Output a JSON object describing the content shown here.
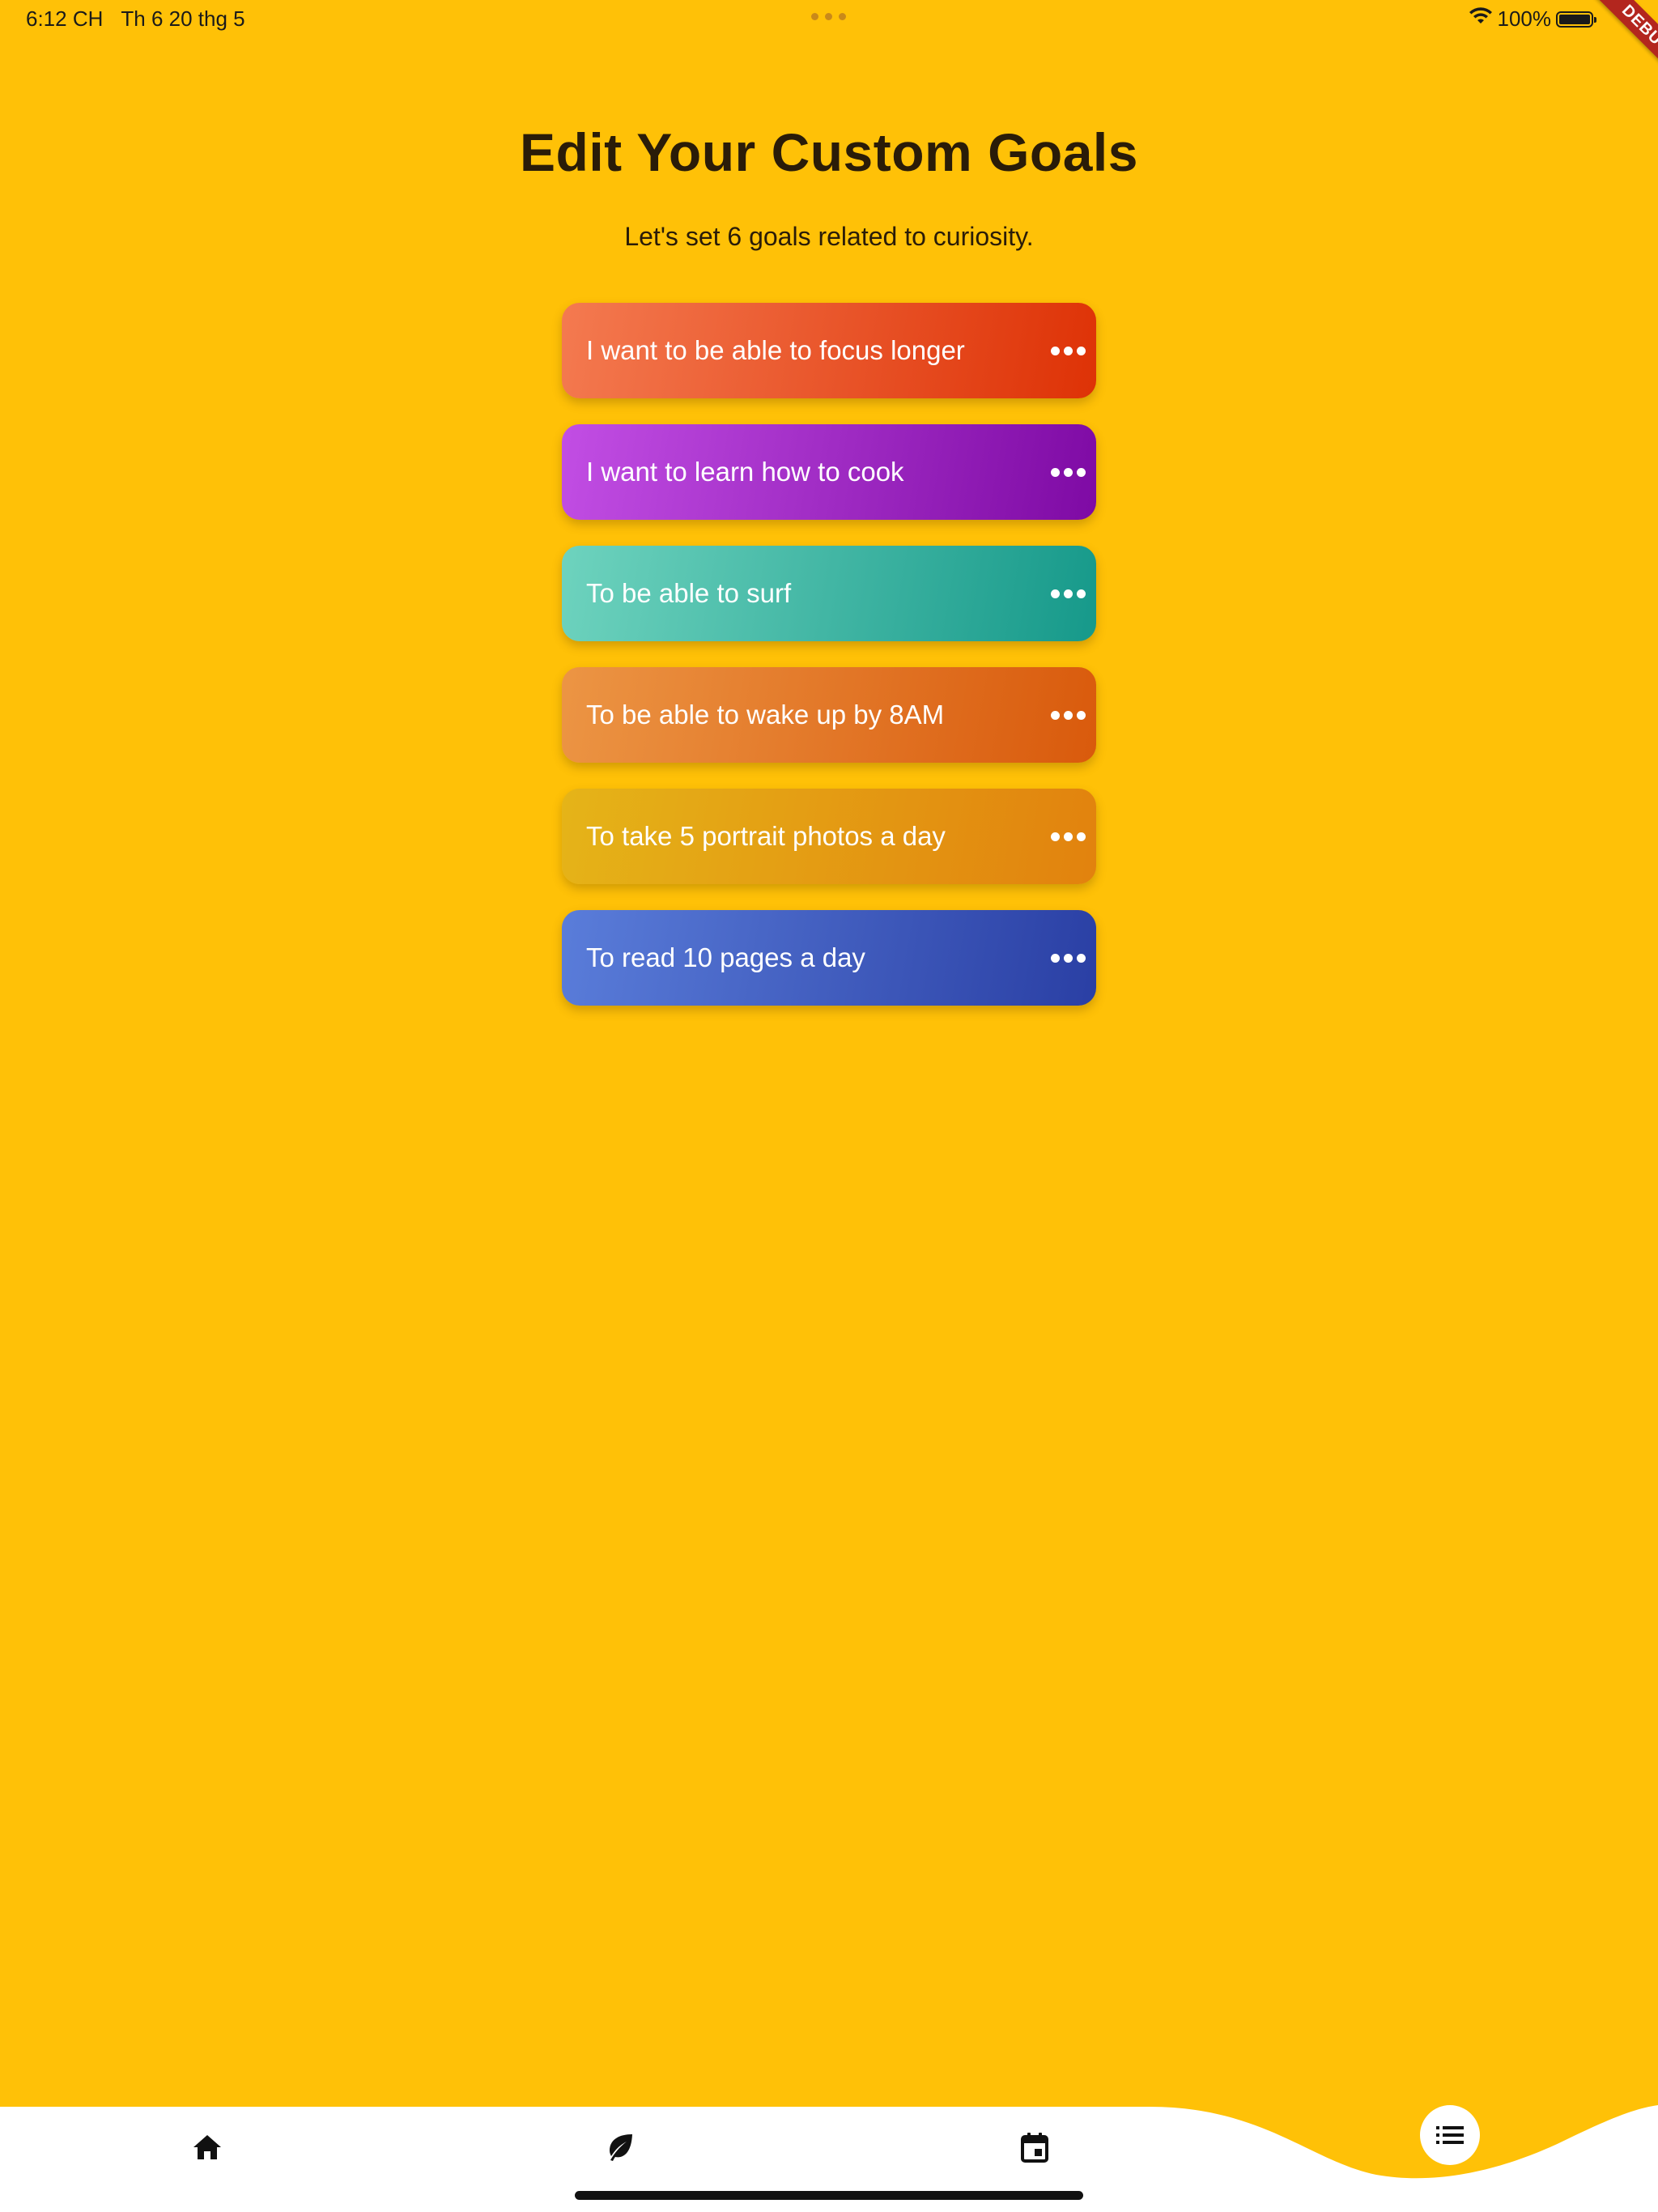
{
  "colors": {
    "background": "#FFC107",
    "nav_background": "#FFFFFF",
    "text_dark": "#2A1C08",
    "debug_banner": "#B3261E"
  },
  "status_bar": {
    "time": "6:12 CH",
    "date": "Th 6 20 thg 5",
    "battery": "100%",
    "wifi_icon": "wifi-icon",
    "battery_icon": "battery-icon"
  },
  "debug_banner": "DEBUG",
  "header": {
    "title": "Edit Your Custom Goals",
    "subtitle": "Let's set 6 goals related to curiosity."
  },
  "goals": [
    {
      "label": "I want to be able to focus longer",
      "gradient": [
        "#F47A50",
        "#DE3206"
      ],
      "menu_icon": "more-horizontal-icon"
    },
    {
      "label": "I want to learn how to cook",
      "gradient": [
        "#C24EE4",
        "#7E0AA4"
      ],
      "menu_icon": "more-horizontal-icon"
    },
    {
      "label": "To be able to surf",
      "gradient": [
        "#6ED3BE",
        "#16998A"
      ],
      "menu_icon": "more-horizontal-icon"
    },
    {
      "label": "To be able to wake up by 8AM",
      "gradient": [
        "#EC9544",
        "#D95A0C"
      ],
      "menu_icon": "more-horizontal-icon"
    },
    {
      "label": "To take 5 portrait photos a day",
      "gradient": [
        "#E5B418",
        "#E2820E"
      ],
      "menu_icon": "more-horizontal-icon"
    },
    {
      "label": "To read 10 pages a day",
      "gradient": [
        "#5A7DDA",
        "#2A3FA4"
      ],
      "menu_icon": "more-horizontal-icon"
    }
  ],
  "bottom_nav": {
    "items": [
      {
        "icon": "home-icon"
      },
      {
        "icon": "leaf-icon"
      },
      {
        "icon": "calendar-icon"
      },
      {
        "icon": "list-icon",
        "active": true
      }
    ]
  }
}
